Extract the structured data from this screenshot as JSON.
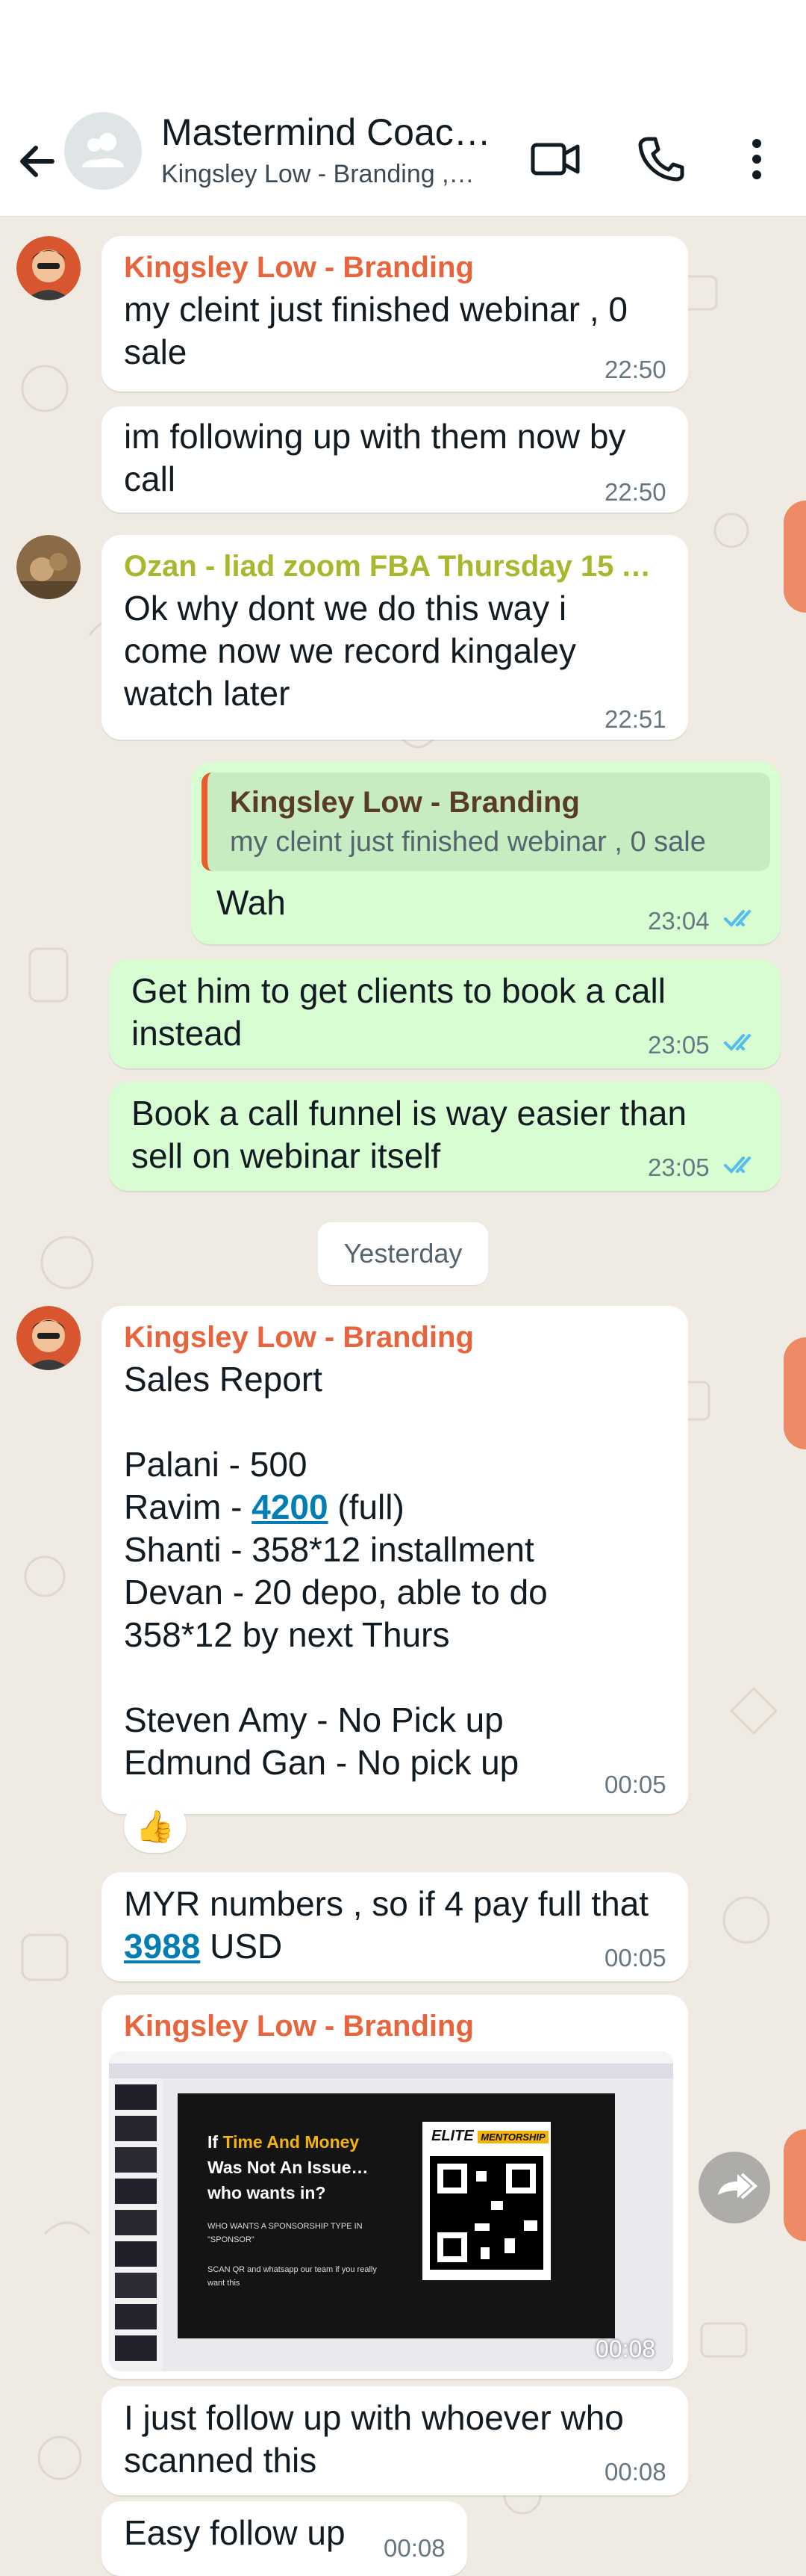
{
  "header": {
    "title": "Mastermind Coac…",
    "subtitle": "Kingsley Low - Branding ,…",
    "icons": [
      "back-arrow-icon",
      "group-avatar-icon",
      "video-call-icon",
      "phone-call-icon",
      "more-vert-icon"
    ]
  },
  "colors": {
    "incoming": "#ffffff",
    "outgoing": "#d9fdd3",
    "chat_background": "#efeae2",
    "sender_kingsley": "#e8643c",
    "sender_ozan": "#a8b72c",
    "read_ticks": "#53bdeb",
    "link": "#027eb5"
  },
  "messages": {
    "m1": {
      "sender": "Kingsley Low - Branding",
      "text": "my cleint just finished webinar , 0 sale",
      "time": "22:50"
    },
    "m2": {
      "text": "im following up with them now by call",
      "time": "22:50"
    },
    "m3": {
      "sender": "Ozan - liad zoom FBA Thursday 15 A…",
      "text": "Ok why dont we do this way i come now we record kingaley watch later",
      "time": "22:51"
    },
    "m4": {
      "quote_sender": "Kingsley Low - Branding",
      "quote_text": "my cleint just finished webinar , 0 sale",
      "text": "Wah",
      "time": "23:04"
    },
    "m5": {
      "text": "Get him to get clients to book a call instead",
      "time": "23:05"
    },
    "m6": {
      "text": "Book a call funnel is way easier than sell on webinar itself",
      "time": "23:05"
    },
    "date_divider": "Yesterday",
    "m7": {
      "sender": "Kingsley Low - Branding",
      "line1": "Sales Report",
      "line2": "Palani - 500",
      "line3_a": "Ravim - ",
      "line3_link": "4200",
      "line3_b": " (full)",
      "line4": "Shanti - 358*12 installment",
      "line5": "Devan - 20 depo, able to do",
      "line6": "358*12 by next Thurs",
      "line7": "Steven Amy - No Pick up",
      "line8": "Edmund Gan - No pick up",
      "time": "00:05",
      "reaction": "👍"
    },
    "m8": {
      "text_a": "MYR numbers , so if 4 pay full that",
      "link": "3988",
      "text_b": " USD",
      "time": "00:05"
    },
    "m9": {
      "sender": "Kingsley Low - Branding",
      "video_duration": "00:08",
      "slide_line1_a": "If ",
      "slide_line1_b": "Time And Money",
      "slide_line2": "Was Not An Issue…",
      "slide_line3": "who wants in?",
      "slide_small1": "WHO WANTS A SPONSORSHIP TYPE IN",
      "slide_small2": "\"SPONSOR\"",
      "slide_small3": "SCAN QR and whatsapp our team if you really",
      "slide_small4": "want this",
      "slide_brand_a": "ELITE",
      "slide_brand_b": "MENTORSHIP"
    },
    "m10": {
      "text": "I just follow up with whoever who scanned this",
      "time": "00:08"
    },
    "m11": {
      "text": "Easy follow up",
      "time": "00:08"
    }
  }
}
